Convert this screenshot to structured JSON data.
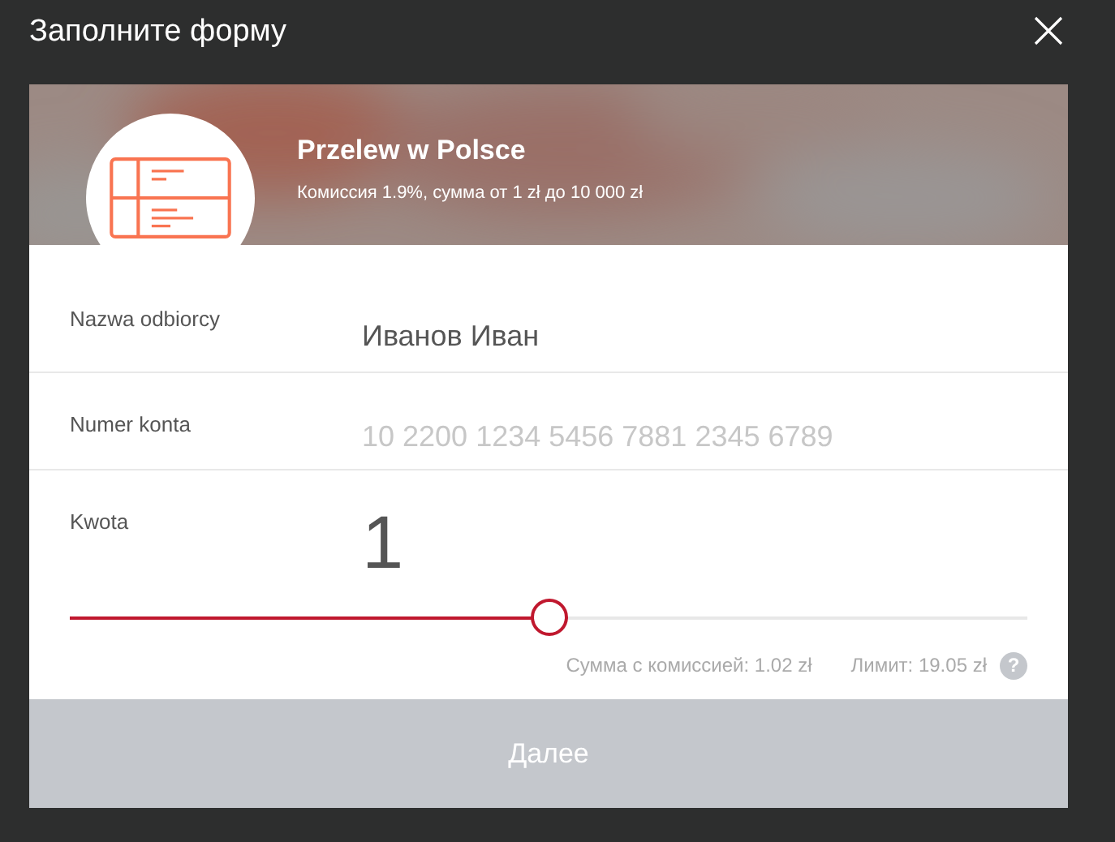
{
  "window": {
    "title": "Заполните форму"
  },
  "transfer": {
    "title": "Przelew w Polsce",
    "subtitle": "Комиссия 1.9%, сумма от 1 zł до 10 000 zł"
  },
  "fields": [
    {
      "kind": "text",
      "label": "Nazwa odbiorcy",
      "value": "Иванов Иван"
    },
    {
      "kind": "text",
      "label": "Numer konta",
      "placeholder": "10 2200 1234 5456 7881 2345 6789"
    },
    {
      "kind": "amount",
      "label": "Kwota",
      "value": "1",
      "level": 0.5,
      "total": "Сумма с комиссией: 1.02 zł",
      "limit": "Лимит: 19.05 zł",
      "help": "?"
    }
  ],
  "button": "Далее"
}
